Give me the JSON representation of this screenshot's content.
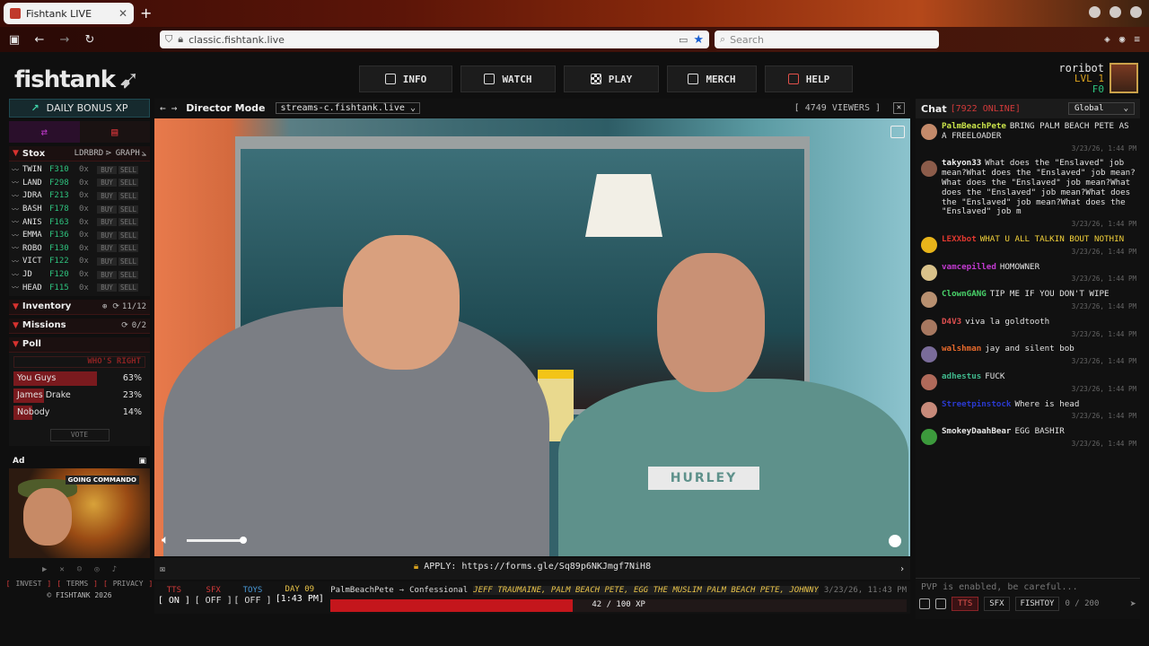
{
  "browser": {
    "tab_title": "Fishtank LIVE",
    "url": "classic.fishtank.live",
    "search_placeholder": "Search"
  },
  "site": {
    "logo": "fishtank",
    "nav": [
      {
        "label": "INFO",
        "icon": "info-icon"
      },
      {
        "label": "WATCH",
        "icon": "video-icon"
      },
      {
        "label": "PLAY",
        "icon": "checker-icon"
      },
      {
        "label": "MERCH",
        "icon": "tv-icon"
      },
      {
        "label": "HELP",
        "icon": "help-icon"
      }
    ],
    "user": {
      "name": "roribot",
      "level": "LVL 1",
      "credits": "₣0"
    }
  },
  "left": {
    "daily_bonus": "DAILY BONUS XP",
    "stox": {
      "title": "Stox",
      "ldrbrd": "LDRBRD",
      "graph": "GRAPH",
      "buy": "BUY",
      "sell": "SELL",
      "rows": [
        {
          "ticker": "TWIN",
          "price": "F310",
          "count": "0x"
        },
        {
          "ticker": "LAND",
          "price": "F298",
          "count": "0x"
        },
        {
          "ticker": "JDRA",
          "price": "F213",
          "count": "0x"
        },
        {
          "ticker": "BASH",
          "price": "F178",
          "count": "0x"
        },
        {
          "ticker": "ANIS",
          "price": "F163",
          "count": "0x"
        },
        {
          "ticker": "EMMA",
          "price": "F136",
          "count": "0x"
        },
        {
          "ticker": "ROBO",
          "price": "F130",
          "count": "0x"
        },
        {
          "ticker": "VICT",
          "price": "F122",
          "count": "0x"
        },
        {
          "ticker": "JD",
          "price": "F120",
          "count": "0x"
        },
        {
          "ticker": "HEAD",
          "price": "F115",
          "count": "0x"
        }
      ]
    },
    "inventory": {
      "title": "Inventory",
      "count": "11/12"
    },
    "missions": {
      "title": "Missions",
      "count": "0/2"
    },
    "poll": {
      "title": "Poll",
      "question": "WHO'S RIGHT",
      "options": [
        {
          "label": "You Guys",
          "percent_text": "63%",
          "share": 0.63
        },
        {
          "label": "James Drake",
          "percent_text": "23%",
          "share": 0.23
        },
        {
          "label": "Nobody",
          "percent_text": "14%",
          "share": 0.14
        }
      ],
      "vote": "VOTE"
    },
    "ad": {
      "title": "Ad",
      "tag": "GOING COMMANDO"
    },
    "links": {
      "invest": "INVEST",
      "terms": "TERMS",
      "privacy": "PRIVACY",
      "copyright": "© FISHTANK 2026"
    }
  },
  "stream": {
    "mode": "Director Mode",
    "server": "streams-c.fishtank.live",
    "viewers": "[ 4749 VIEWERS ]",
    "shirt_text": "HURLEY",
    "apply": "APPLY: https://forms.gle/Sq89p6NKJmgf7NiH8"
  },
  "hud": {
    "tts": {
      "label": "TTS",
      "value": "[ ON ]"
    },
    "sfx": {
      "label": "SFX",
      "value": "[ OFF ]"
    },
    "toys": {
      "label": "TOYS",
      "value": "[ OFF ]"
    },
    "day": {
      "label": "DAY 09",
      "time": "[1:43 PM]"
    },
    "feed": {
      "from": "PalmBeachPete",
      "arrow": "→",
      "to": "Confessional",
      "ticker": "JEFF TRAUMAINE, PALM BEACH PETE, EGG THE MUSLIM PALM BEACH PETE, JOHNNY",
      "time": "3/23/26, 11:43 PM"
    },
    "xp": {
      "label": "42 / 100 XP",
      "fraction": 0.42
    }
  },
  "chat": {
    "title": "Chat",
    "online": "[7922 ONLINE]",
    "channel": "Global",
    "messages": [
      {
        "user": "PalmBeachPete",
        "color": "#c9e24a",
        "text": "BRING PALM BEACH PETE AS A FREELOADER",
        "time": "3/23/26, 1:44 PM",
        "avatar": "#c48a6a"
      },
      {
        "user": "takyon33",
        "color": "#f0f0f0",
        "text": "What does the \"Enslaved\" job mean?What does the \"Enslaved\" job mean?What does the \"Enslaved\" job mean?What does the \"Enslaved\" job mean?What does the \"Enslaved\" job mean?What does the \"Enslaved\" job m",
        "time": "3/23/26, 1:44 PM",
        "avatar": "#8c5c4a"
      },
      {
        "user": "LEXXbot",
        "color": "#e0382f",
        "text": "WHAT U ALL TALKIN BOUT NOTHIN",
        "text_color": "#f2d13a",
        "time": "3/23/26, 1:44 PM",
        "avatar": "#e8b41a"
      },
      {
        "user": "vamcepilled",
        "color": "#c23ad0",
        "text": "HOMOWNER",
        "time": "3/23/26, 1:44 PM",
        "avatar": "#d9c28a"
      },
      {
        "user": "ClownGANG",
        "color": "#49d36a",
        "text": "TIP ME IF YOU DON'T WIPE",
        "time": "3/23/26, 1:44 PM",
        "avatar": "#b89070"
      },
      {
        "user": "D4V3",
        "color": "#e05050",
        "text": "viva la goldtooth",
        "time": "3/23/26, 1:44 PM",
        "avatar": "#a77860"
      },
      {
        "user": "walshman",
        "color": "#e86a2c",
        "text": "jay and silent bob",
        "time": "3/23/26, 1:44 PM",
        "avatar": "#7a6c9a"
      },
      {
        "user": "adhestus",
        "color": "#3fb88c",
        "text": "FUCK",
        "time": "3/23/26, 1:44 PM",
        "avatar": "#b06a5a"
      },
      {
        "user": "Streetpinstock",
        "color": "#2a3ad0",
        "text": "Where is head",
        "time": "3/23/26, 1:44 PM",
        "avatar": "#c78a7a"
      },
      {
        "user": "SmokeyDaahBear",
        "color": "#e6e6e6",
        "text": "EGG BASHIR",
        "time": "3/23/26, 1:44 PM",
        "avatar": "#3c9a3c"
      }
    ],
    "input_placeholder": "PVP is enabled, be careful...",
    "tts_button": "TTS",
    "sfx_button": "SFX",
    "fishtoy_button": "FISHTOY",
    "char_count": "0 / 200"
  }
}
